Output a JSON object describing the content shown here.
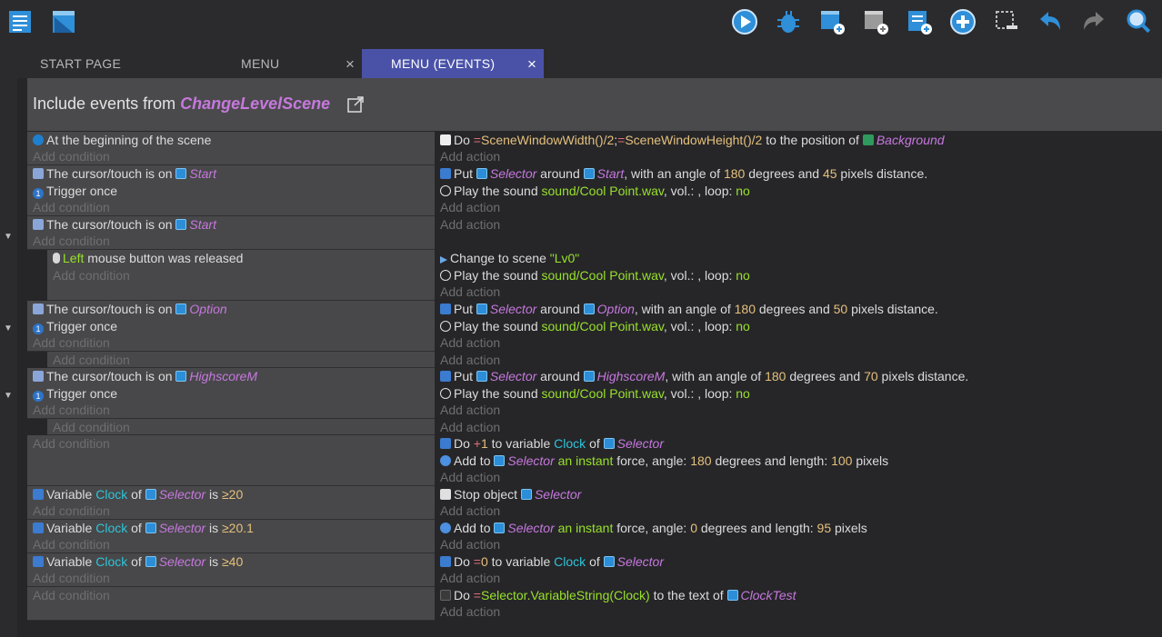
{
  "toolbar": {
    "icons": [
      "events-list-icon",
      "scene-window-icon",
      "preview-play-icon",
      "debug-bug-icon",
      "add-event-icon",
      "add-subevent-icon",
      "add-comment-icon",
      "add-more-icon",
      "delete-selection-icon",
      "undo-icon",
      "redo-icon",
      "search-icon"
    ]
  },
  "tabs": [
    {
      "label": "START PAGE"
    },
    {
      "label": "MENU",
      "close": "×"
    },
    {
      "label": "MENU (EVENTS)",
      "close": "×"
    }
  ],
  "include": {
    "prefix": "Include events from",
    "scene": "ChangeLevelScene"
  },
  "placeholders": {
    "condition": "Add condition",
    "action": "Add action"
  },
  "events": {
    "e1": {
      "c1": "At the beginning of the scene",
      "a1": {
        "do": "Do",
        "eq": "=",
        "x": "SceneWindowWidth()/2",
        "sep": ";",
        "eq2": "=",
        "y": "SceneWindowHeight()/2",
        "mid": "to the position of",
        "obj": "Background"
      }
    },
    "e2": {
      "c1": {
        "pre": "The cursor/touch is on",
        "obj": "Start"
      },
      "c2": "Trigger once",
      "a1": {
        "pre": "Put",
        "obj": "Selector",
        "mid": "around",
        "obj2": "Start",
        "t1": ", with an angle of",
        "n1": "180",
        "t2": "degrees and",
        "n2": "45",
        "t3": "pixels distance."
      },
      "a2": {
        "pre": "Play the sound",
        "file": "sound/Cool Point.wav",
        "t1": ", vol.: , loop:",
        "loop": "no"
      }
    },
    "e3": {
      "c1": {
        "pre": "The cursor/touch is on",
        "obj": "Start"
      }
    },
    "e3s": {
      "c1": {
        "btn": "Left",
        "rest": "mouse button was released"
      },
      "a1": {
        "pre": "Change to scene",
        "scene": "\"Lv0\""
      },
      "a2": {
        "pre": "Play the sound",
        "file": "sound/Cool Point.wav",
        "t1": ", vol.: , loop:",
        "loop": "no"
      }
    },
    "e4": {
      "c1": {
        "pre": "The cursor/touch is on",
        "obj": "Option"
      },
      "c2": "Trigger once",
      "a1": {
        "pre": "Put",
        "obj": "Selector",
        "mid": "around",
        "obj2": "Option",
        "t1": ", with an angle of",
        "n1": "180",
        "t2": "degrees and",
        "n2": "50",
        "t3": "pixels distance."
      },
      "a2": {
        "pre": "Play the sound",
        "file": "sound/Cool Point.wav",
        "t1": ", vol.: , loop:",
        "loop": "no"
      }
    },
    "e5": {
      "c1": {
        "pre": "The cursor/touch is on",
        "obj": "HighscoreM"
      },
      "c2": "Trigger once",
      "a1": {
        "pre": "Put",
        "obj": "Selector",
        "mid": "around",
        "obj2": "HighscoreM",
        "t1": ", with an angle of",
        "n1": "180",
        "t2": "degrees and",
        "n2": "70",
        "t3": "pixels distance."
      },
      "a2": {
        "pre": "Play the sound",
        "file": "sound/Cool Point.wav",
        "t1": ", vol.: , loop:",
        "loop": "no"
      }
    },
    "e6": {
      "a1": {
        "do": "Do",
        "op": "+",
        "n": "1",
        "t1": "to variable",
        "var": "Clock",
        "of": "of",
        "obj": "Selector"
      },
      "a2": {
        "pre": "Add to",
        "obj": "Selector",
        "kind": "an instant",
        "t1": "force, angle:",
        "n1": "180",
        "t2": "degrees and length:",
        "n2": "100",
        "t3": "pixels"
      }
    },
    "e7": {
      "c1": {
        "pre": "Variable",
        "var": "Clock",
        "of": "of",
        "obj": "Selector",
        "is": "is",
        "cmp": "≥20"
      },
      "a1": {
        "pre": "Stop object",
        "obj": "Selector"
      }
    },
    "e8": {
      "c1": {
        "pre": "Variable",
        "var": "Clock",
        "of": "of",
        "obj": "Selector",
        "is": "is",
        "cmp": "≥20.1"
      },
      "a1": {
        "pre": "Add to",
        "obj": "Selector",
        "kind": "an instant",
        "t1": "force, angle:",
        "n1": "0",
        "t2": "degrees and length:",
        "n2": "95",
        "t3": "pixels"
      }
    },
    "e9": {
      "c1": {
        "pre": "Variable",
        "var": "Clock",
        "of": "of",
        "obj": "Selector",
        "is": "is",
        "cmp": "≥40"
      },
      "a1": {
        "do": "Do",
        "op": "=",
        "n": "0",
        "t1": "to variable",
        "var": "Clock",
        "of": "of",
        "obj": "Selector"
      }
    },
    "e10": {
      "a1": {
        "do": "Do",
        "op": "=",
        "expr": "Selector.VariableString(Clock)",
        "t1": "to the text of",
        "obj": "ClockTest"
      }
    }
  },
  "colors": {
    "tab_active": "#4a52a8",
    "object": "#c678dd",
    "number": "#e5c07b",
    "string": "#98e02a",
    "variable": "#2ec4d8",
    "operator": "#e06c75"
  }
}
